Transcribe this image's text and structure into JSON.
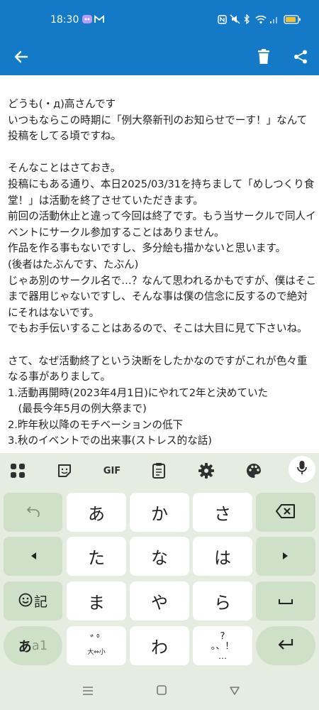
{
  "status_bar": {
    "time": "18:30",
    "battery_color": "#f3c232"
  },
  "toolbar": {
    "back_icon": "arrow-left-icon",
    "delete_icon": "trash-icon",
    "share_icon": "share-icon"
  },
  "post": {
    "body": "どうも(・д)高さんです\nいつもならこの時期に「例大祭新刊のお知らせでーす！」なんて投稿をしてる頃ですね。\n\nそんなことはさておき。\n投稿にもある通り、本日2025/03/31を持ちまして「めしつくり食堂！」は活動を終了させていただきます。\n前回の活動休止と違って今回は終了です。もう当サークルで同人イベントにサークル参加することはありません。\n作品を作る事もないですし、多分絵も描かないと思います。\n(後者はたぶんです、たぶん)\nじゃあ別のサークル名で…？なんて思われるかもですが、僕はそこまで器用じゃないですし、そんな事は僕の信念に反するので絶対にそれはないです。\nでもお手伝いすることはあるので、そこは大目に見て下さいね。\n\nさて、なぜ活動終了という決断をしたかなのですがこれが色々重なる事がありまして。\n1.活動再開時(2023年4月1日)にやれて2年と決めていた\n　(最長今年5月の例大祭まで)\n2.昨年秋以降のモチベーションの低下\n3.秋のイベントでの出来事(ストレス的な話)"
  },
  "keyboard": {
    "toolbar": {
      "gif_label": "GIF"
    },
    "keys": {
      "a": "あ",
      "ka": "か",
      "sa": "さ",
      "ta": "た",
      "na": "な",
      "ha": "は",
      "ma": "ま",
      "ya": "や",
      "ra": "ら",
      "wa": "わ",
      "emoji_kigo_label": "記",
      "mode_kana": "あ",
      "mode_alpha": "a1",
      "dakuten_top": "ﾞﾟ",
      "dakuten_bottom": "大⇔小",
      "punct_top": "?",
      "punct_bottom": "。、！",
      "punct_dots": "…"
    }
  },
  "navigation_bar": {
    "recent_icon": "recents-icon",
    "home_icon": "home-icon",
    "back_icon": "nav-back-icon"
  }
}
